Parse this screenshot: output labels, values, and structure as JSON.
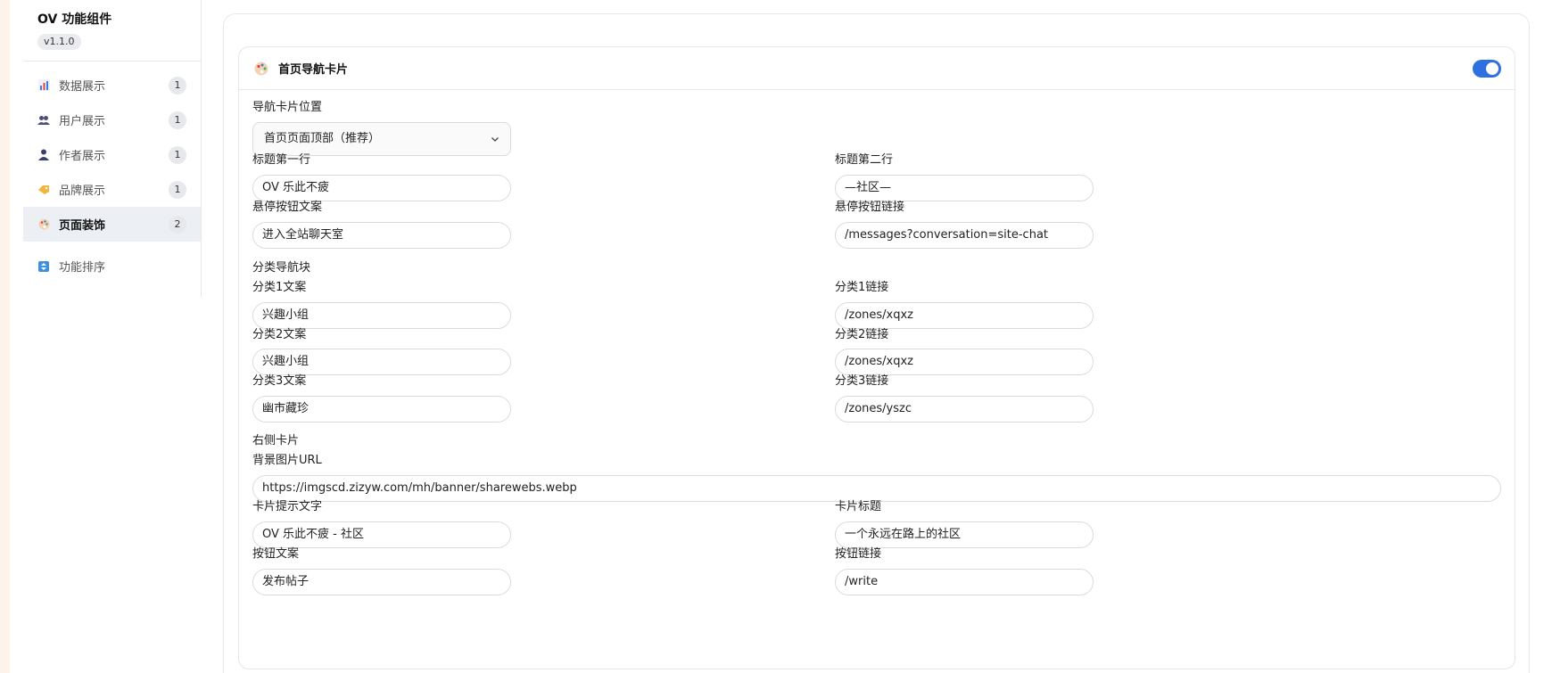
{
  "app": {
    "title": "OV 功能组件",
    "version": "v1.1.0"
  },
  "sidebar": {
    "items": [
      {
        "label": "数据展示",
        "count": "1"
      },
      {
        "label": "用户展示",
        "count": "1"
      },
      {
        "label": "作者展示",
        "count": "1"
      },
      {
        "label": "品牌展示",
        "count": "1"
      },
      {
        "label": "页面装饰",
        "count": "2"
      }
    ],
    "extra": {
      "label": "功能排序"
    }
  },
  "card": {
    "title": "首页导航卡片",
    "toggle_on": true,
    "position": {
      "label": "导航卡片位置",
      "value": "首页页面顶部（推荐）"
    },
    "title_line1": {
      "label": "标题第一行",
      "value": "OV 乐此不疲"
    },
    "title_line2": {
      "label": "标题第二行",
      "value": "—社区—"
    },
    "hover_text": {
      "label": "悬停按钮文案",
      "value": "进入全站聊天室"
    },
    "hover_link": {
      "label": "悬停按钮链接",
      "value": "/messages?conversation=site-chat"
    },
    "category_section": "分类导航块",
    "cat1_text": {
      "label": "分类1文案",
      "value": "兴趣小组"
    },
    "cat1_link": {
      "label": "分类1链接",
      "value": "/zones/xqxz"
    },
    "cat2_text": {
      "label": "分类2文案",
      "value": "兴趣小组"
    },
    "cat2_link": {
      "label": "分类2链接",
      "value": "/zones/xqxz"
    },
    "cat3_text": {
      "label": "分类3文案",
      "value": "幽市藏珍"
    },
    "cat3_link": {
      "label": "分类3链接",
      "value": "/zones/yszc"
    },
    "right_section": "右侧卡片",
    "bg_url": {
      "label": "背景图片URL",
      "value": "https://imgscd.zizyw.com/mh/banner/sharewebs.webp"
    },
    "card_tip": {
      "label": "卡片提示文字",
      "value": "OV 乐此不疲 - 社区"
    },
    "card_title": {
      "label": "卡片标题",
      "value": "一个永远在路上的社区"
    },
    "btn_text": {
      "label": "按钮文案",
      "value": "发布帖子"
    },
    "btn_link": {
      "label": "按钮链接",
      "value": "/write"
    }
  },
  "colors": {
    "accent": "#2f6fe0",
    "active_bg": "#eceff3",
    "border": "#e6e8eb"
  }
}
